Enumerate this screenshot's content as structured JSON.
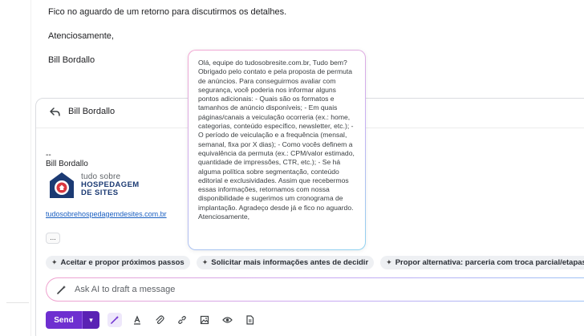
{
  "email": {
    "line1": "Fico no aguardo de um retorno para discutirmos os detalhes.",
    "line2": "Atenciosamente,",
    "line3": "Bill Bordallo"
  },
  "reply": {
    "recipient": "Bill Bordallo",
    "icon": "reply-icon"
  },
  "signature": {
    "dash": "--",
    "name": "Bill Bordallo",
    "logo_line1": "tudo sobre",
    "logo_line2": "HOSPEDAGEM",
    "logo_line3": "DE SITES",
    "link": "tudosobrehospedagemdesites.com.br",
    "more": "..."
  },
  "suggestions": [
    {
      "label": "Aceitar e propor próximos passos",
      "icon": "sparkle-icon"
    },
    {
      "label": "Solicitar mais informações antes de decidir",
      "icon": "sparkle-icon"
    },
    {
      "label": "Propor alternativa: parceria com troca parcial/etapas",
      "icon": "sparkle-icon"
    }
  ],
  "ai": {
    "placeholder": "Ask AI to draft a message",
    "icon": "magic-wand-icon"
  },
  "toolbar": {
    "send_label": "Send",
    "icons": [
      "chevron-down-icon",
      "magic-wand-icon",
      "text-format-icon",
      "attachment-icon",
      "link-icon",
      "image-icon",
      "eye-icon",
      "document-icon"
    ]
  },
  "popup": {
    "text": "Olá, equipe do tudosobresite.com.br, Tudo bem? Obrigado pelo contato e pela proposta de permuta de anúncios. Para conseguirmos avaliar com segurança, você poderia nos informar alguns pontos adicionais: - Quais são os formatos e tamanhos de anúncio disponíveis; - Em quais páginas/canais a veiculação ocorreria (ex.: home, categorias, conteúdo específico, newsletter, etc.); - O período de veiculação e a frequência (mensal, semanal, fixa por X dias); - Como vocês definem a equivalência da permuta (ex.: CPM/valor estimado, quantidade de impressões, CTR, etc.); - Se há alguma política sobre segmentação, conteúdo editorial e exclusividades. Assim que recebermos essas informações, retornamos com nossa disponibilidade e sugerimos um cronograma de implantação. Agradeço desde já e fico no aguardo. Atenciosamente,"
  },
  "colors": {
    "accent": "#6e2fd0",
    "link": "#1a5fc1",
    "brand": "#1b3a73",
    "brand_red": "#d9363e"
  }
}
